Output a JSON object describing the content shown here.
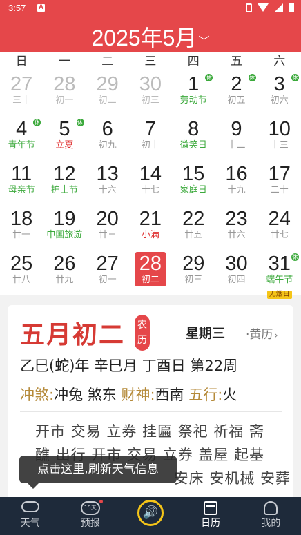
{
  "status": {
    "time": "3:57",
    "badge": "A"
  },
  "header": {
    "title": "2025年5月",
    "chevron": "﹀"
  },
  "weekdays": [
    "日",
    "一",
    "二",
    "三",
    "四",
    "五",
    "六"
  ],
  "days": [
    {
      "num": "27",
      "sub": "三十",
      "other": true
    },
    {
      "num": "28",
      "sub": "初一",
      "other": true
    },
    {
      "num": "29",
      "sub": "初二",
      "other": true
    },
    {
      "num": "30",
      "sub": "初三",
      "other": true
    },
    {
      "num": "1",
      "sub": "劳动节",
      "subcolor": "green",
      "xiu": "休"
    },
    {
      "num": "2",
      "sub": "初五",
      "xiu": "休"
    },
    {
      "num": "3",
      "sub": "初六",
      "xiu": "休"
    },
    {
      "num": "4",
      "sub": "青年节",
      "subcolor": "green",
      "xiu": "休"
    },
    {
      "num": "5",
      "sub": "立夏",
      "subcolor": "red",
      "xiu": "休"
    },
    {
      "num": "6",
      "sub": "初九"
    },
    {
      "num": "7",
      "sub": "初十"
    },
    {
      "num": "8",
      "sub": "微笑日",
      "subcolor": "green"
    },
    {
      "num": "9",
      "sub": "十二"
    },
    {
      "num": "10",
      "sub": "十三"
    },
    {
      "num": "11",
      "sub": "母亲节",
      "subcolor": "green"
    },
    {
      "num": "12",
      "sub": "护士节",
      "subcolor": "green"
    },
    {
      "num": "13",
      "sub": "十六"
    },
    {
      "num": "14",
      "sub": "十七"
    },
    {
      "num": "15",
      "sub": "家庭日",
      "subcolor": "green"
    },
    {
      "num": "16",
      "sub": "十九"
    },
    {
      "num": "17",
      "sub": "二十"
    },
    {
      "num": "18",
      "sub": "廿一"
    },
    {
      "num": "19",
      "sub": "中国旅游",
      "subcolor": "green"
    },
    {
      "num": "20",
      "sub": "廿三"
    },
    {
      "num": "21",
      "sub": "小满",
      "subcolor": "red"
    },
    {
      "num": "22",
      "sub": "廿五"
    },
    {
      "num": "23",
      "sub": "廿六"
    },
    {
      "num": "24",
      "sub": "廿七"
    },
    {
      "num": "25",
      "sub": "廿八"
    },
    {
      "num": "26",
      "sub": "廿九"
    },
    {
      "num": "27",
      "sub": "初一"
    },
    {
      "num": "28",
      "sub": "初二",
      "selected": true
    },
    {
      "num": "29",
      "sub": "初三"
    },
    {
      "num": "30",
      "sub": "初四"
    },
    {
      "num": "31",
      "sub": "端午节",
      "subcolor": "green",
      "xiu": "休",
      "tag": "无烟日"
    }
  ],
  "detail": {
    "big_date": "五月初二",
    "nongli": "农历",
    "weekday": "星期三",
    "huangli": "·黄历",
    "huangli_chev": "›",
    "ganzhi": "乙巳(蛇)年 辛巳月 丁酉日 第22周",
    "chong_label": "冲煞:",
    "chong_value": "冲兔 煞东",
    "caishen_label": "财神:",
    "caishen_value": "西南",
    "wuxing_label": "五行:",
    "wuxing_value": "火",
    "yi_line1": "开市 交易 立券 挂匾 祭祀 祈福 斋",
    "yi_line2": "醮 出行 开市 交易 立券 盖屋 起基",
    "yi_line3": "  安床 安机械 安葬"
  },
  "toast": "点击这里,刷新天气信息",
  "tabs": [
    {
      "label": "天气"
    },
    {
      "label": "预报",
      "icon_text": "15天"
    },
    {
      "label": "",
      "icon_text": "🔊"
    },
    {
      "label": "日历"
    },
    {
      "label": "我的"
    }
  ],
  "colors": {
    "brand": "#e5474a",
    "festival": "#3ba93b",
    "term": "#e03030",
    "tabbar": "#1e2a3a",
    "accent": "#f5c518"
  }
}
